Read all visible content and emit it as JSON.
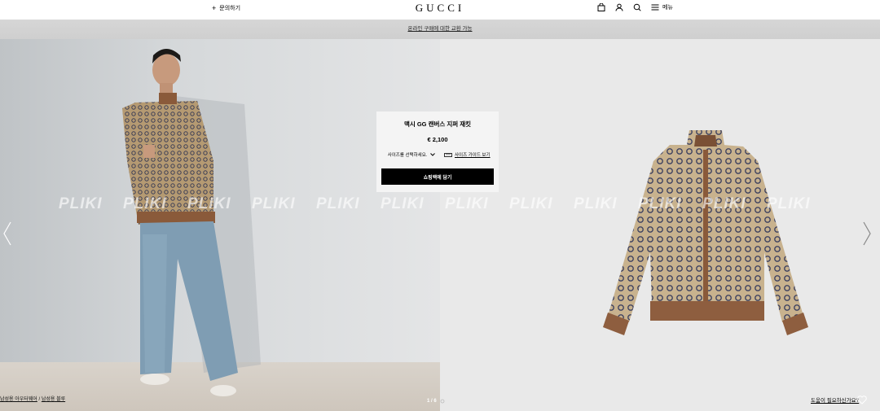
{
  "header": {
    "contact_label": "문의하기",
    "logo": "GUCCI",
    "menu_label": "메뉴"
  },
  "banner": {
    "text": "온라인 구매에 대한 교환 가능"
  },
  "product": {
    "title": "맥시 GG 캔버스 지퍼 재킷",
    "price": "€ 2,100",
    "size_select_label": "사이즈를 선택하세요.",
    "size_guide_label": "사이즈 가이드 보기",
    "add_to_cart_label": "쇼핑백에 담기"
  },
  "watermark": {
    "text": "PLIKI"
  },
  "breadcrumb": {
    "item1": "남성용 아우터웨어",
    "separator": "/",
    "item2": "남성용 블루"
  },
  "pager": {
    "text": "1 / 6"
  },
  "help": {
    "label": "도움이 필요하신가요?"
  },
  "colors": {
    "accent": "#000000",
    "banner_bg": "#d3d3d3",
    "right_bg": "#e9e9e9"
  }
}
